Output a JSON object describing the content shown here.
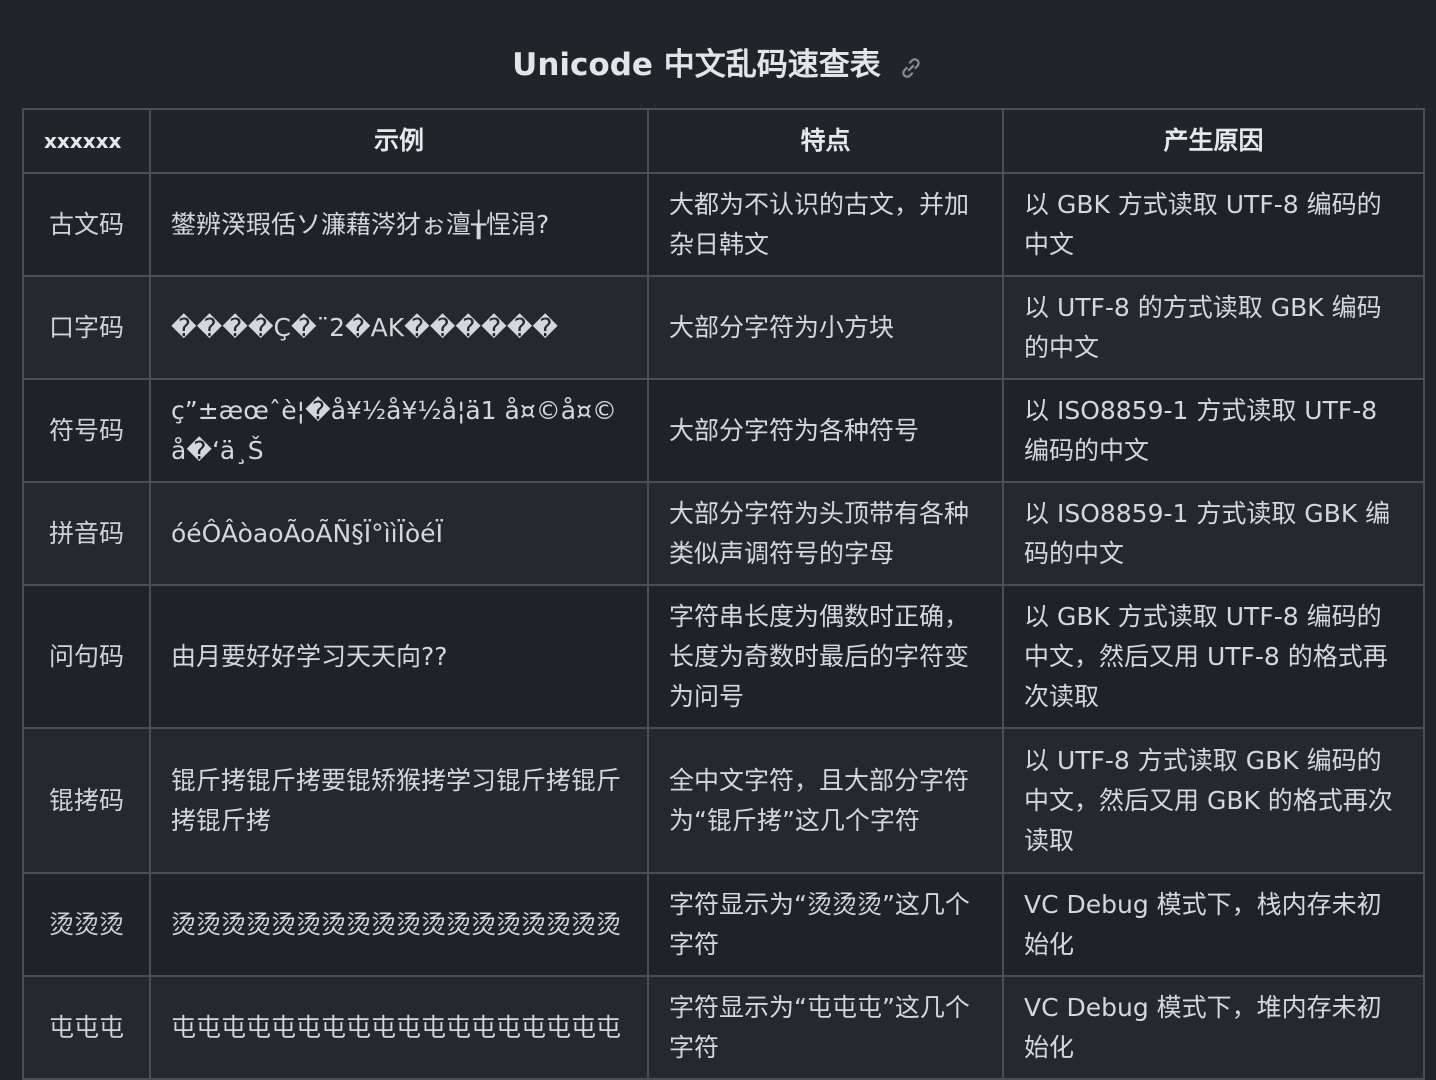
{
  "title": "Unicode 中文乱码速查表",
  "link_icon": "link-icon",
  "table": {
    "headers": [
      "xxxxxx",
      "示例",
      "特点",
      "产生原因"
    ],
    "rows": [
      {
        "name": "古文码",
        "example": "鐢辨湀瑕佸ソ濂藉涔犲ぉ澶╁悜涓?",
        "feature": "大都为不认识的古文，并加杂日韩文",
        "cause": "以 GBK 方式读取 UTF-8 编码的中文"
      },
      {
        "name": "口字码",
        "example": "����Ç�¨2�ΑΚ������",
        "feature": "大部分字符为小方块",
        "cause": "以 UTF-8 的方式读取 GBK 编码的中文"
      },
      {
        "name": "符号码",
        "example": "ç”±æœˆè¦�å¥½å¥½å­¦ä1 å¤©å¤©å�‘ä¸Š",
        "feature": "大部分字符为各种符号",
        "cause": "以 ISO8859-1 方式读取 UTF-8 编码的中文"
      },
      {
        "name": "拼音码",
        "example": "óéÔÂòaoÃoÃÑ§Ï°ììÏòéÏ",
        "feature": "大部分字符为头顶带有各种类似声调符号的字母",
        "cause": "以 ISO8859-1 方式读取 GBK 编码的中文"
      },
      {
        "name": "问句码",
        "example": "由月要好好学习天天向??",
        "feature": "字符串长度为偶数时正确，长度为奇数时最后的字符变为问号",
        "cause": "以 GBK 方式读取 UTF-8 编码的中文，然后又用 UTF-8 的格式再次读取"
      },
      {
        "name": "锟拷码",
        "example": "锟斤拷锟斤拷要锟矫猴拷学习锟斤拷锟斤拷锟斤拷",
        "feature": "全中文字符，且大部分字符为“锟斤拷”这几个字符",
        "cause": "以 UTF-8 方式读取 GBK 编码的中文，然后又用 GBK 的格式再次读取"
      },
      {
        "name": "烫烫烫",
        "example": "烫烫烫烫烫烫烫烫烫烫烫烫烫烫烫烫烫烫",
        "feature": "字符显示为“烫烫烫”这几个字符",
        "cause": "VC Debug 模式下，栈内存未初始化"
      },
      {
        "name": "屯屯屯",
        "example": "屯屯屯屯屯屯屯屯屯屯屯屯屯屯屯屯屯屯",
        "feature": "字符显示为“屯屯屯”这几个字符",
        "cause": "VC Debug 模式下，堆内存未初始化"
      }
    ]
  }
}
